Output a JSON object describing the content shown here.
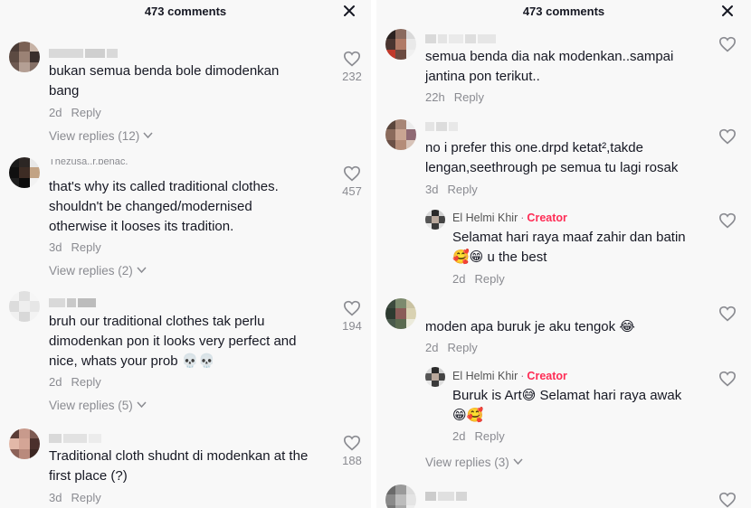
{
  "left": {
    "header_title": "473 comments",
    "comments": [
      {
        "text_lines": [
          "bukan semua benda bole dimodenkan",
          "bang"
        ],
        "age": "2d",
        "reply": "Reply",
        "likes": "232",
        "view_replies": "View replies (12)"
      },
      {
        "username": "Thezusa..r.benac.",
        "text_lines": [
          "that's why its called traditional clothes.",
          "shouldn't be changed/modernised",
          "otherwise it looses its tradition."
        ],
        "age": "3d",
        "reply": "Reply",
        "likes": "457",
        "view_replies": "View replies (2)"
      },
      {
        "text_lines": [
          "bruh our traditional clothes tak perlu",
          "dimodenkan pon it looks very perfect and",
          "nice, whats your prob 💀💀"
        ],
        "age": "2d",
        "reply": "Reply",
        "likes": "194",
        "view_replies": "View replies (5)"
      },
      {
        "text_lines": [
          "Traditional cloth shudnt di modenkan at the",
          "first place (?)"
        ],
        "age": "3d",
        "reply": "Reply",
        "likes": "188"
      }
    ]
  },
  "right": {
    "header_title": "473 comments",
    "comments": [
      {
        "text_lines": [
          "semua benda dia nak modenkan..sampai",
          "jantina pon terikut.."
        ],
        "age": "22h",
        "reply": "Reply"
      },
      {
        "text_lines": [
          "no i prefer this one.drpd ketat²,takde",
          "lengan,seethrough pe semua tu lagi rosak"
        ],
        "age": "3d",
        "reply": "Reply"
      },
      {
        "creator_name": "El Helmi Khir",
        "creator_tag": "Creator",
        "text_lines": [
          "Selamat hari raya maaf zahir dan batin",
          "🥰😁 u the best"
        ],
        "age": "2d",
        "reply": "Reply"
      },
      {
        "text_lines": [
          "moden apa buruk je aku tengok 😂"
        ],
        "age": "2d",
        "reply": "Reply"
      },
      {
        "creator_name": "El Helmi Khir",
        "creator_tag": "Creator",
        "text_lines": [
          "Buruk is Art😅 Selamat hari raya awak",
          "😁🥰"
        ],
        "age": "2d",
        "reply": "Reply"
      },
      {
        "view_replies": "View replies (3)"
      }
    ]
  },
  "icons": {
    "close": "close-icon",
    "like": "heart-outline-icon",
    "chevron": "chevron-down-icon"
  },
  "colors": {
    "creator_tag": "#fe2c55",
    "meta": "#8a8b91",
    "text": "#161823",
    "panel_bg": "#f8f8f8"
  }
}
